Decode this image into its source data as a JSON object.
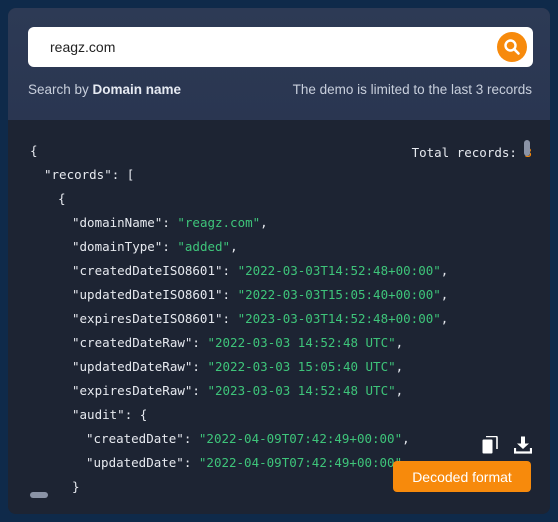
{
  "search": {
    "value": "reagz.com",
    "hint_prefix": "Search by ",
    "hint_field": "Domain name",
    "limit_notice": "The demo is limited to the last 3 records"
  },
  "result": {
    "total_label": "Total records: ",
    "total_count": "3",
    "decoded_button_label": "Decoded format",
    "lines": {
      "l1": "{",
      "l2_key": "\"records\"",
      "l2_rest": ": [",
      "l3": "{",
      "l4_key": "\"domainName\"",
      "l4_val": "\"reagz.com\"",
      "l5_key": "\"domainType\"",
      "l5_val": "\"added\"",
      "l6_key": "\"createdDateISO8601\"",
      "l6_val": "\"2022-03-03T14:52:48+00:00\"",
      "l7_key": "\"updatedDateISO8601\"",
      "l7_val": "\"2022-03-03T15:05:40+00:00\"",
      "l8_key": "\"expiresDateISO8601\"",
      "l8_val": "\"2023-03-03T14:52:48+00:00\"",
      "l9_key": "\"createdDateRaw\"",
      "l9_val": "\"2022-03-03 14:52:48 UTC\"",
      "l10_key": "\"updatedDateRaw\"",
      "l10_val": "\"2022-03-03 15:05:40 UTC\"",
      "l11_key": "\"expiresDateRaw\"",
      "l11_val": "\"2023-03-03 14:52:48 UTC\"",
      "l12_key": "\"audit\"",
      "l12_rest": ": {",
      "l13_key": "\"createdDate\"",
      "l13_val": "\"2022-04-09T07:42:49+00:00\"",
      "l14_key": "\"updatedDate\"",
      "l14_val": "\"2022-04-09T07:42:49+00:00\"",
      "l15": "}"
    }
  },
  "icons": {
    "search": "search-icon",
    "copy": "copy-icon",
    "download": "download-icon"
  },
  "colors": {
    "accent": "#f78a0c",
    "string": "#3ec47a",
    "background": "#0f2a4a",
    "panel_header": "#2d3a55",
    "code_background": "#1d2433"
  }
}
